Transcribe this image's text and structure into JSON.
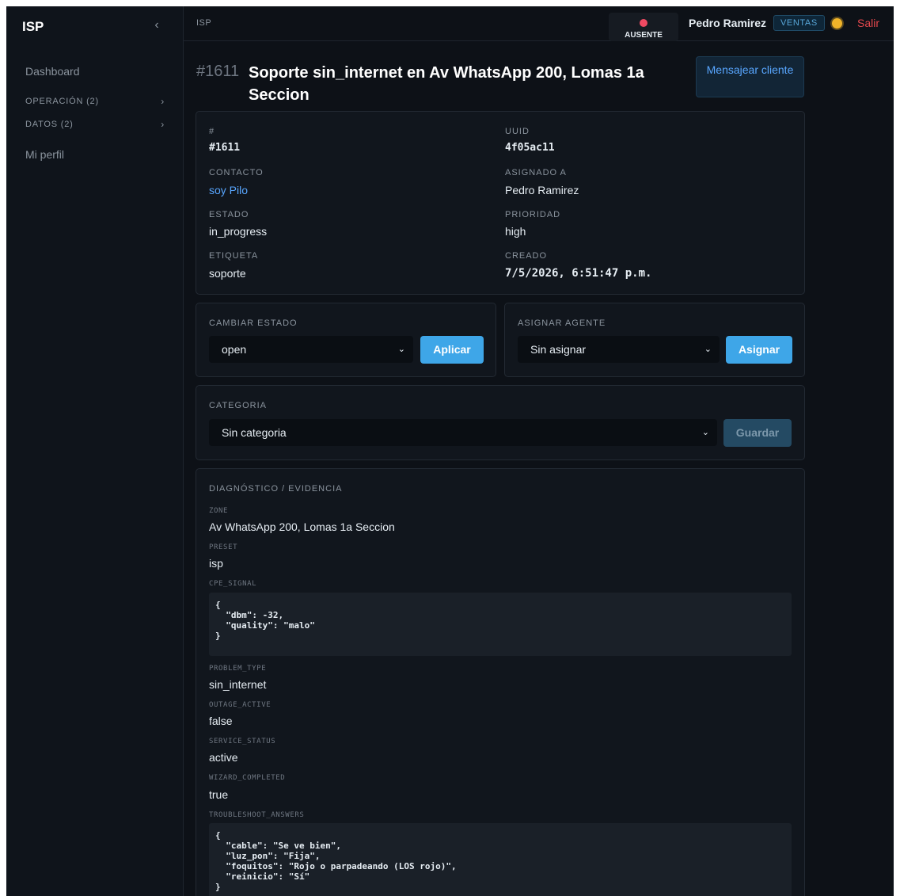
{
  "sidebar": {
    "brand": "ISP",
    "collapse_icon": "‹",
    "items": [
      {
        "label": "Dashboard"
      },
      {
        "label": "OPERACIÓN (2)"
      },
      {
        "label": "DATOS (2)"
      },
      {
        "label": "Mi perfil"
      }
    ]
  },
  "topbar": {
    "breadcrumb": "ISP",
    "presence": {
      "label": "AUSENTE",
      "color": "#f04a63"
    },
    "user_name": "Pedro Ramirez",
    "role_badge": "VENTAS",
    "theme_icon": "sun-icon",
    "logout_label": "Salir"
  },
  "ticket": {
    "number": "#1611",
    "title": "Soporte sin_internet en Av WhatsApp 200, Lomas 1a Seccion",
    "message_button": "Mensajear cliente",
    "details": {
      "id_label": "#",
      "id_value": "#1611",
      "uuid_label": "UUID",
      "uuid_value": "4f05ac11",
      "contact_label": "CONTACTO",
      "contact_value": "soy Pilo",
      "assigned_label": "ASIGNADO A",
      "assigned_value": "Pedro Ramirez",
      "status_label": "ESTADO",
      "status_value": "in_progress",
      "priority_label": "PRIORIDAD",
      "priority_value": "high",
      "tag_label": "ETIQUETA",
      "tag_value": "soporte",
      "created_label": "CREADO",
      "created_value": "7/5/2026, 6:51:47 p.m."
    }
  },
  "change_status": {
    "label": "CAMBIAR ESTADO",
    "selected": "open",
    "button": "Aplicar"
  },
  "assign_agent": {
    "label": "ASIGNAR AGENTE",
    "selected": "Sin asignar",
    "button": "Asignar"
  },
  "category": {
    "label": "CATEGORIA",
    "selected": "Sin categoria",
    "button": "Guardar"
  },
  "diagnostics": {
    "title": "DIAGNÓSTICO / EVIDENCIA",
    "zone_label": "ZONE",
    "zone_value": "Av WhatsApp 200, Lomas 1a Seccion",
    "preset_label": "PRESET",
    "preset_value": "isp",
    "cpe_label": "CPE_SIGNAL",
    "cpe_value": "{\n  \"dbm\": -32,\n  \"quality\": \"malo\"\n}",
    "problem_label": "PROBLEM_TYPE",
    "problem_value": "sin_internet",
    "outage_label": "OUTAGE_ACTIVE",
    "outage_value": "false",
    "service_label": "SERVICE_STATUS",
    "service_value": "active",
    "wizard_label": "WIZARD_COMPLETED",
    "wizard_value": "true",
    "troubleshoot_label": "TROUBLESHOOT_ANSWERS",
    "troubleshoot_value": "{\n  \"cable\": \"Se ve bien\",\n  \"luz_pon\": \"Fija\",\n  \"foquitos\": \"Rojo o parpadeando (LOS rojo)\",\n  \"reinicio\": \"Sí\"\n}"
  }
}
